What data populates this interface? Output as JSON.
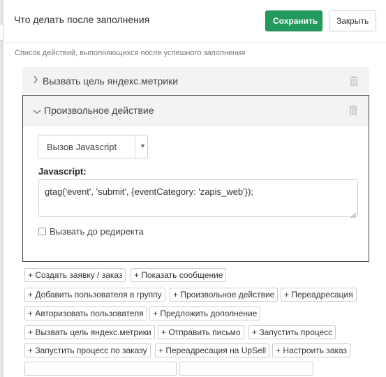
{
  "header": {
    "title": "Что делать после заполнения",
    "save_label": "Сохранить",
    "close_label": "Закрыть"
  },
  "subtitle": "Список действий, выполняющихся после успешного заполнения",
  "actions_list": [
    {
      "label": "Вызвать цель яндекс.метрики",
      "expanded": false
    },
    {
      "label": "Произвольное действие",
      "expanded": true
    }
  ],
  "custom_action": {
    "select_value": "Вызов Javascript",
    "js_label": "Javascript:",
    "js_code": "gtag('event', 'submit', {eventCategory: 'zapis_web'});",
    "checkbox_label": "Вызвать до редиректа",
    "checkbox_checked": false
  },
  "add_buttons": [
    [
      "+ Создать заявку / заказ",
      "+ Показать сообщение"
    ],
    [
      "+ Добавить пользователя в группу",
      "+ Произвольное действие",
      "+ Переадресация"
    ],
    [
      "+ Авторизовать пользователя",
      "+ Предложить дополнение"
    ],
    [
      "+ Вызвать цель яндекс.метрики",
      "+ Отправить письмо",
      "+ Запустить процесс"
    ],
    [
      "+ Запустить процесс по заказу",
      "+ Переадресация на UpSell",
      "+ Настроить заказ"
    ]
  ],
  "icons": {
    "collapsed": "chevron-right-icon",
    "expanded": "chevron-down-icon",
    "delete": "trash-icon",
    "select": "caret-down-icon"
  },
  "colors": {
    "save_button": "#229a5e",
    "panel_border": "#444444",
    "row_background": "#f3f3f3"
  }
}
